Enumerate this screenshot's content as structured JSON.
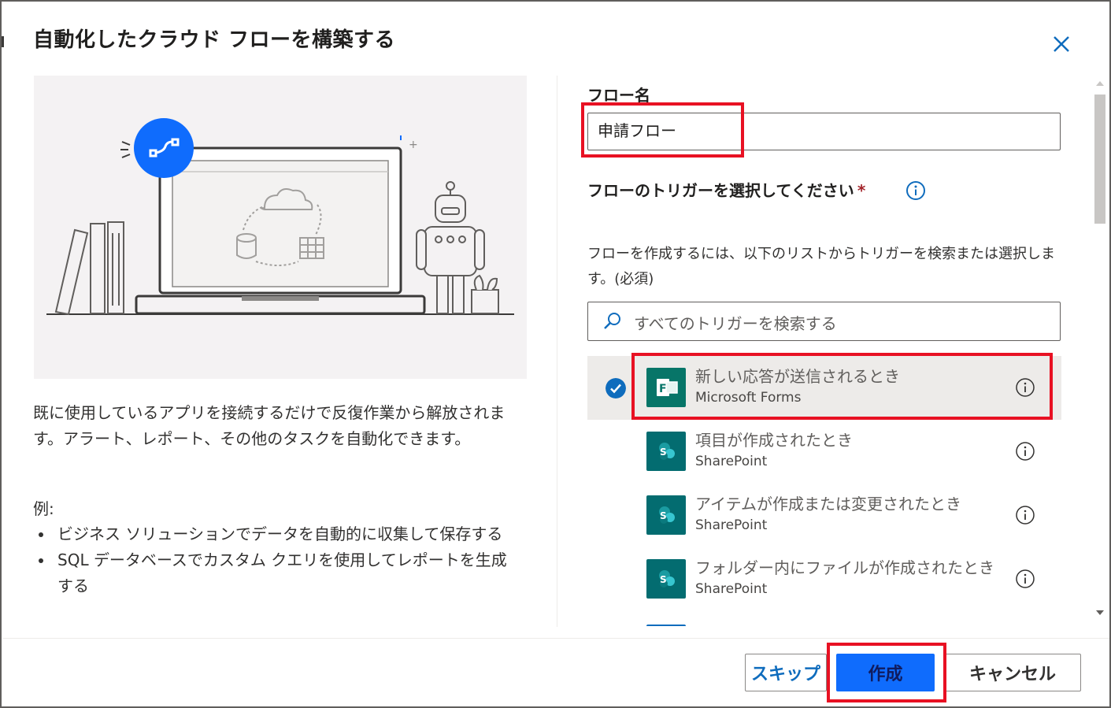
{
  "dialog": {
    "title": "自動化したクラウド フローを構築する",
    "close_icon": "close-icon"
  },
  "left": {
    "description": "既に使用しているアプリを接続するだけで反復作業から解放されます。アラート、レポート、その他のタスクを自動化できます。",
    "examples_label": "例:",
    "examples": [
      "ビジネス ソリューションでデータを自動的に収集して保存する",
      "SQL データベースでカスタム クエリを使用してレポートを生成する"
    ]
  },
  "form": {
    "flow_name_label": "フロー名",
    "flow_name_value": "申請フロー",
    "trigger_label": "フローのトリガーを選択してください",
    "required_mark": "*",
    "hint": "フローを作成するには、以下のリストからトリガーを検索または選択します。(必須)",
    "search_placeholder": "すべてのトリガーを検索する"
  },
  "triggers": [
    {
      "name": "新しい応答が送信されるとき",
      "connector": "Microsoft Forms",
      "selected": true,
      "icon": "forms-icon"
    },
    {
      "name": "項目が作成されたとき",
      "connector": "SharePoint",
      "selected": false,
      "icon": "sharepoint-icon"
    },
    {
      "name": "アイテムが作成または変更されたとき",
      "connector": "SharePoint",
      "selected": false,
      "icon": "sharepoint-icon"
    },
    {
      "name": "フォルダー内にファイルが作成されたとき",
      "connector": "SharePoint",
      "selected": false,
      "icon": "sharepoint-icon"
    }
  ],
  "footer": {
    "skip_label": "スキップ",
    "create_label": "作成",
    "cancel_label": "キャンセル"
  },
  "colors": {
    "accent": "#0f6cbd",
    "highlight": "#e81123",
    "create_button": "#0f6cfd",
    "forms_brand": "#077568",
    "sharepoint_brand": "#036c70"
  }
}
